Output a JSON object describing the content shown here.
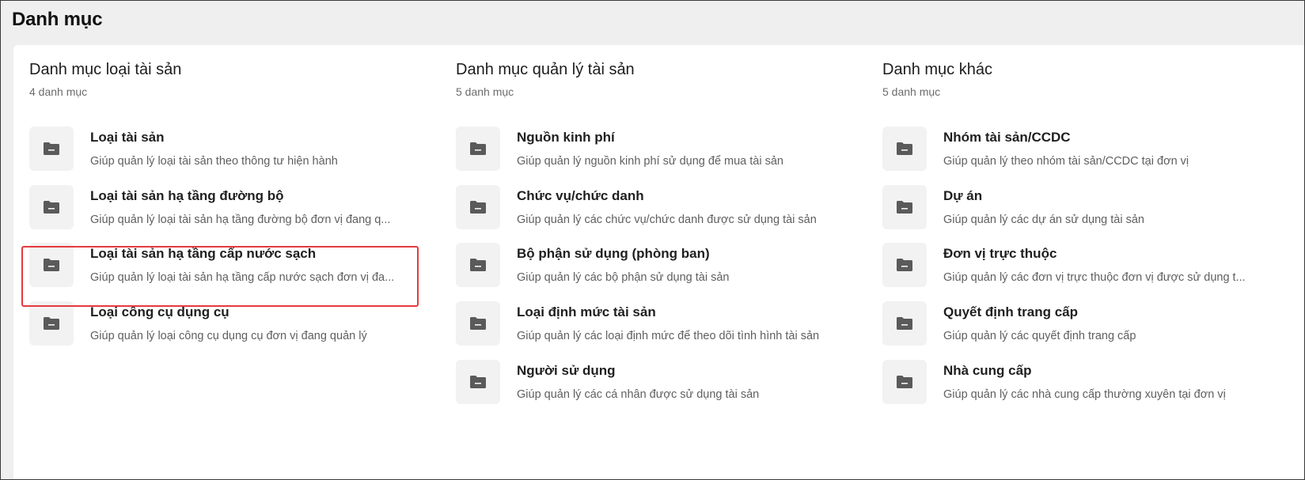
{
  "page": {
    "title": "Danh mục"
  },
  "colors": {
    "highlight": "#e5393f",
    "icon": "#5a5a5a",
    "icon_bg": "#f2f2f2"
  },
  "columns": [
    {
      "title": "Danh mục loại tài sản",
      "count": "4 danh mục",
      "items": [
        {
          "name": "Loại tài sản",
          "desc": "Giúp quản lý loại tài sản theo thông tư hiện hành",
          "icon": "folder-icon"
        },
        {
          "name": "Loại tài sản hạ tầng đường bộ",
          "desc": "Giúp quản lý loại tài sản hạ tầng đường bộ đơn vị đang q...",
          "icon": "folder-icon"
        },
        {
          "name": "Loại tài sản hạ tầng cấp nước sạch",
          "desc": "Giúp quản lý loại tài sản hạ tầng cấp nước sạch đơn vị đa...",
          "icon": "folder-icon"
        },
        {
          "name": "Loại công cụ dụng cụ",
          "desc": "Giúp quản lý loại công cụ dụng cụ đơn vị đang quản lý",
          "icon": "folder-icon"
        }
      ]
    },
    {
      "title": "Danh mục quản lý tài sản",
      "count": "5 danh mục",
      "items": [
        {
          "name": "Nguồn kinh phí",
          "desc": "Giúp quản lý nguồn kinh phí sử dụng để mua tài sản",
          "icon": "folder-icon"
        },
        {
          "name": "Chức vụ/chức danh",
          "desc": "Giúp quản lý các chức vụ/chức danh được sử dụng tài sản",
          "icon": "folder-icon"
        },
        {
          "name": "Bộ phận sử dụng (phòng ban)",
          "desc": "Giúp quản lý các bộ phận sử dụng tài sản",
          "icon": "folder-icon"
        },
        {
          "name": "Loại định mức tài sản",
          "desc": "Giúp quản lý các loại định mức để theo dõi tình hình tài sản",
          "icon": "folder-icon"
        },
        {
          "name": "Người sử dụng",
          "desc": "Giúp quản lý các cá nhân được sử dụng tài sản",
          "icon": "folder-icon"
        }
      ]
    },
    {
      "title": "Danh mục khác",
      "count": "5 danh mục",
      "items": [
        {
          "name": "Nhóm tài sản/CCDC",
          "desc": "Giúp quản lý theo nhóm tài sản/CCDC tại đơn vị",
          "icon": "folder-icon"
        },
        {
          "name": "Dự án",
          "desc": "Giúp quản lý các dự án sử dụng tài sản",
          "icon": "folder-icon"
        },
        {
          "name": "Đơn vị trực thuộc",
          "desc": "Giúp quản lý các đơn vị trực thuộc đơn vị được sử dụng t...",
          "icon": "folder-icon"
        },
        {
          "name": "Quyết định trang cấp",
          "desc": "Giúp quản lý các quyết định trang cấp",
          "icon": "folder-icon"
        },
        {
          "name": "Nhà cung cấp",
          "desc": "Giúp quản lý các nhà cung cấp thường xuyên tại đơn vị",
          "icon": "folder-icon"
        }
      ]
    }
  ]
}
